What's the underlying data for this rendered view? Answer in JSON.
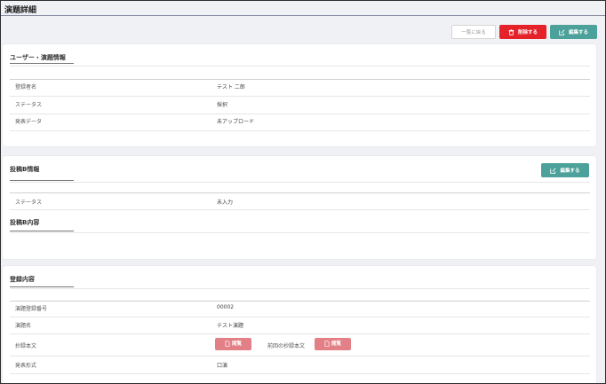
{
  "page": {
    "title": "演題詳細"
  },
  "toolbar": {
    "back_label": "一覧に戻る",
    "delete_label": "削除する",
    "edit_label": "編集する"
  },
  "user_section": {
    "title": "ユーザー・演題情報",
    "rows": [
      {
        "label": "登録者名",
        "value": "テスト 二郎"
      },
      {
        "label": "ステータス",
        "value": "採択"
      },
      {
        "label": "発表データ",
        "value": "未アップロード"
      }
    ]
  },
  "postB_section": {
    "title": "投稿B情報",
    "edit_label": "編集する",
    "rows": [
      {
        "label": "ステータス",
        "value": "未入力"
      }
    ],
    "content_title": "投稿B内容"
  },
  "registration_section": {
    "title": "登録内容",
    "rows": [
      {
        "label": "演題登録番号",
        "value": "00002"
      },
      {
        "label": "演題名",
        "value": "テスト演題"
      },
      {
        "label": "抄録本文",
        "value": ""
      },
      {
        "label": "発表形式",
        "value": "口演"
      }
    ],
    "view_label": "閲覧",
    "prev_abstract_label": "前回の抄録本文",
    "prev_view_label": "閲覧"
  },
  "colors": {
    "danger": "#e5212a",
    "primary": "#4ca19a",
    "view": "#e37f86"
  }
}
